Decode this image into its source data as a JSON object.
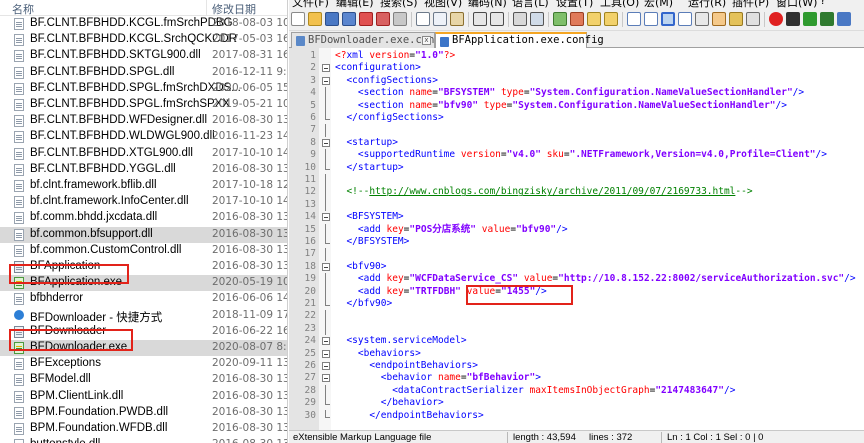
{
  "explorer": {
    "col_name": "名称",
    "col_date": "修改日期",
    "files": [
      {
        "name": "BF.CLNT.BFBHDD.KCGL.fmSrchPDBG",
        "date": "2018-08-03 10:",
        "icon": "file"
      },
      {
        "name": "BF.CLNT.BFBHDD.KCGL.SrchQCKCDR",
        "date": "2017-05-03 16:",
        "icon": "file"
      },
      {
        "name": "BF.CLNT.BFBHDD.SKTGL900.dll",
        "date": "2017-08-31 16:",
        "icon": "file"
      },
      {
        "name": "BF.CLNT.BFBHDD.SPGL.dll",
        "date": "2016-12-11 9:1",
        "icon": "file"
      },
      {
        "name": "BF.CLNT.BFBHDD.SPGL.fmSrchDXDS...",
        "date": "2020-06-05 15:",
        "icon": "file"
      },
      {
        "name": "BF.CLNT.BFBHDD.SPGL.fmSrchSPXX",
        "date": "2019-05-21 10:",
        "icon": "file"
      },
      {
        "name": "BF.CLNT.BFBHDD.WFDesigner.dll",
        "date": "2016-08-30 13:",
        "icon": "file"
      },
      {
        "name": "BF.CLNT.BFBHDD.WLDWGL900.dll",
        "date": "2016-11-23 14:",
        "icon": "file"
      },
      {
        "name": "BF.CLNT.BFBHDD.XTGL900.dll",
        "date": "2017-10-10 14:",
        "icon": "file"
      },
      {
        "name": "BF.CLNT.BFBHDD.YGGL.dll",
        "date": "2016-08-30 13:",
        "icon": "file"
      },
      {
        "name": "bf.clnt.framework.bflib.dll",
        "date": "2017-10-18 12:",
        "icon": "file"
      },
      {
        "name": "bf.clnt.framework.InfoCenter.dll",
        "date": "2017-10-10 14:",
        "icon": "file"
      },
      {
        "name": "bf.comm.bhdd.jxcdata.dll",
        "date": "2016-08-30 13:",
        "icon": "file"
      },
      {
        "name": "bf.common.bfsupport.dll",
        "date": "2016-08-30 13:",
        "icon": "file",
        "selected": true
      },
      {
        "name": "bf.common.CustomControl.dll",
        "date": "2016-08-30 13:",
        "icon": "file"
      },
      {
        "name": "BFApplication",
        "date": "2016-08-30 13:",
        "icon": "gear"
      },
      {
        "name": "BFApplication.exe",
        "date": "2020-05-19 10:",
        "icon": "exe",
        "selected": true
      },
      {
        "name": "bfbhderror",
        "date": "2016-06-06 14:",
        "icon": "file"
      },
      {
        "name": "BFDownloader - 快捷方式",
        "date": "2018-11-09 17:",
        "icon": "shortcut"
      },
      {
        "name": "BFDownloader",
        "date": "2016-06-22 16:",
        "icon": "gear"
      },
      {
        "name": "BFDownloader.exe",
        "date": "2020-08-07 8:2",
        "icon": "exe",
        "selected": true
      },
      {
        "name": "BFExceptions",
        "date": "2020-09-11 13:",
        "icon": "file"
      },
      {
        "name": "BFModel.dll",
        "date": "2016-08-30 13:",
        "icon": "file"
      },
      {
        "name": "BPM.ClientLink.dll",
        "date": "2016-08-30 13:",
        "icon": "file"
      },
      {
        "name": "BPM.Foundation.PWDB.dll",
        "date": "2016-08-30 13:",
        "icon": "file"
      },
      {
        "name": "BPM.Foundation.WFDB.dll",
        "date": "2016-08-30 13:",
        "icon": "file"
      },
      {
        "name": "buttonstyle.dll",
        "date": "2016-08-30 13:",
        "icon": "file"
      }
    ]
  },
  "npp": {
    "menu": [
      "文件(F)",
      "编辑(E)",
      "搜索(S)",
      "视图(V)",
      "编码(N)",
      "语言(L)",
      "设置(T)",
      "工具(O)",
      "宏(M)",
      "运行(R)",
      "插件(P)",
      "窗口(W)",
      "?"
    ],
    "tabs": [
      {
        "label": "BFDownloader.exe.config",
        "active": false,
        "close": "x"
      },
      {
        "label": "BFApplication.exe.config",
        "active": true,
        "close": "x"
      }
    ],
    "colors": {
      "tag": "#0000ff",
      "attr": "#ff0000",
      "value": "#8000ff",
      "comment": "#008000",
      "highlight_box": "#e2231a",
      "active_tab_accent": "#f5a623"
    },
    "lines": [
      {
        "n": "1",
        "fold": "none",
        "tokens": [
          [
            "pi",
            "<?"
          ],
          [
            "tag",
            "xml"
          ],
          [
            "txt",
            " "
          ],
          [
            "attr",
            "version"
          ],
          [
            "txt",
            "="
          ],
          [
            "val",
            "\"1.0\""
          ],
          [
            "pi",
            "?>"
          ]
        ]
      },
      {
        "n": "2",
        "fold": "box",
        "tokens": [
          [
            "tag",
            "<configuration>"
          ]
        ]
      },
      {
        "n": "3",
        "fold": "box",
        "tokens": [
          [
            "txt",
            "  "
          ],
          [
            "tag",
            "<configSections>"
          ]
        ]
      },
      {
        "n": "4",
        "fold": "line",
        "tokens": [
          [
            "txt",
            "    "
          ],
          [
            "tag",
            "<section "
          ],
          [
            "attr",
            "name"
          ],
          [
            "txt",
            "="
          ],
          [
            "val",
            "\"BFSYSTEM\""
          ],
          [
            "txt",
            " "
          ],
          [
            "attr",
            "type"
          ],
          [
            "txt",
            "="
          ],
          [
            "val",
            "\"System.Configuration.NameValueSectionHandler\""
          ],
          [
            "tag",
            "/>"
          ]
        ]
      },
      {
        "n": "5",
        "fold": "line",
        "tokens": [
          [
            "txt",
            "    "
          ],
          [
            "tag",
            "<section "
          ],
          [
            "attr",
            "name"
          ],
          [
            "txt",
            "="
          ],
          [
            "val",
            "\"bfv90\""
          ],
          [
            "txt",
            " "
          ],
          [
            "attr",
            "type"
          ],
          [
            "txt",
            "="
          ],
          [
            "val",
            "\"System.Configuration.NameValueSectionHandler\""
          ],
          [
            "tag",
            "/>"
          ]
        ]
      },
      {
        "n": "6",
        "fold": "end",
        "tokens": [
          [
            "txt",
            "  "
          ],
          [
            "tag",
            "</configSections>"
          ]
        ]
      },
      {
        "n": "7",
        "fold": "line",
        "tokens": []
      },
      {
        "n": "8",
        "fold": "box",
        "tokens": [
          [
            "txt",
            "  "
          ],
          [
            "tag",
            "<startup>"
          ]
        ]
      },
      {
        "n": "9",
        "fold": "line",
        "tokens": [
          [
            "txt",
            "    "
          ],
          [
            "tag",
            "<supportedRuntime "
          ],
          [
            "attr",
            "version"
          ],
          [
            "txt",
            "="
          ],
          [
            "val",
            "\"v4.0\""
          ],
          [
            "txt",
            " "
          ],
          [
            "attr",
            "sku"
          ],
          [
            "txt",
            "="
          ],
          [
            "val",
            "\".NETFramework,Version=v4.0,Profile=Client\""
          ],
          [
            "tag",
            "/>"
          ]
        ]
      },
      {
        "n": "10",
        "fold": "end",
        "tokens": [
          [
            "txt",
            "  "
          ],
          [
            "tag",
            "</startup>"
          ]
        ]
      },
      {
        "n": "11",
        "fold": "line",
        "tokens": []
      },
      {
        "n": "12",
        "fold": "line",
        "tokens": [
          [
            "txt",
            "  "
          ],
          [
            "com",
            "<!--"
          ],
          [
            "link",
            "http://www.cnblogs.com/bingzisky/archive/2011/09/07/2169733.html"
          ],
          [
            "com",
            "-->"
          ]
        ]
      },
      {
        "n": "13",
        "fold": "line",
        "tokens": []
      },
      {
        "n": "14",
        "fold": "box",
        "tokens": [
          [
            "txt",
            "  "
          ],
          [
            "tag",
            "<BFSYSTEM>"
          ]
        ]
      },
      {
        "n": "15",
        "fold": "line",
        "tokens": [
          [
            "txt",
            "    "
          ],
          [
            "tag",
            "<add "
          ],
          [
            "attr",
            "key"
          ],
          [
            "txt",
            "="
          ],
          [
            "val",
            "\"POS分店系统\""
          ],
          [
            "txt",
            " "
          ],
          [
            "attr",
            "value"
          ],
          [
            "txt",
            "="
          ],
          [
            "val",
            "\"bfv90\""
          ],
          [
            "tag",
            "/>"
          ]
        ]
      },
      {
        "n": "16",
        "fold": "end",
        "tokens": [
          [
            "txt",
            "  "
          ],
          [
            "tag",
            "</BFSYSTEM>"
          ]
        ]
      },
      {
        "n": "17",
        "fold": "line",
        "tokens": []
      },
      {
        "n": "18",
        "fold": "box",
        "tokens": [
          [
            "txt",
            "  "
          ],
          [
            "tag",
            "<bfv90>"
          ]
        ]
      },
      {
        "n": "19",
        "fold": "line",
        "tokens": [
          [
            "txt",
            "    "
          ],
          [
            "tag",
            "<add "
          ],
          [
            "attr",
            "key"
          ],
          [
            "txt",
            "="
          ],
          [
            "val",
            "\"WCFDataService_CS\""
          ],
          [
            "txt",
            " "
          ],
          [
            "attr",
            "value"
          ],
          [
            "txt",
            "="
          ],
          [
            "val",
            "\"http://10.8.152.22:8002/serviceAuthorization.svc\""
          ],
          [
            "tag",
            "/>"
          ]
        ]
      },
      {
        "n": "20",
        "fold": "line",
        "tokens": [
          [
            "txt",
            "    "
          ],
          [
            "tag",
            "<add "
          ],
          [
            "attr",
            "key"
          ],
          [
            "txt",
            "="
          ],
          [
            "val",
            "\"TRTFDBH\""
          ],
          [
            "txt",
            " "
          ],
          [
            "attr",
            "value"
          ],
          [
            "txt",
            "="
          ],
          [
            "val",
            "\"1455\""
          ],
          [
            "tag",
            "/>"
          ]
        ]
      },
      {
        "n": "21",
        "fold": "end",
        "tokens": [
          [
            "txt",
            "  "
          ],
          [
            "tag",
            "</bfv90>"
          ]
        ]
      },
      {
        "n": "22",
        "fold": "line",
        "tokens": []
      },
      {
        "n": "23",
        "fold": "line",
        "tokens": []
      },
      {
        "n": "24",
        "fold": "box",
        "tokens": [
          [
            "txt",
            "  "
          ],
          [
            "tag",
            "<system.serviceModel>"
          ]
        ]
      },
      {
        "n": "25",
        "fold": "box",
        "tokens": [
          [
            "txt",
            "    "
          ],
          [
            "tag",
            "<behaviors>"
          ]
        ]
      },
      {
        "n": "26",
        "fold": "box",
        "tokens": [
          [
            "txt",
            "      "
          ],
          [
            "tag",
            "<endpointBehaviors>"
          ]
        ]
      },
      {
        "n": "27",
        "fold": "box",
        "tokens": [
          [
            "txt",
            "        "
          ],
          [
            "tag",
            "<behavior "
          ],
          [
            "attr",
            "name"
          ],
          [
            "txt",
            "="
          ],
          [
            "val",
            "\"bfBehavior\""
          ],
          [
            "tag",
            ">"
          ]
        ]
      },
      {
        "n": "28",
        "fold": "line",
        "tokens": [
          [
            "txt",
            "          "
          ],
          [
            "tag",
            "<dataContractSerializer "
          ],
          [
            "attr",
            "maxItemsInObjectGraph"
          ],
          [
            "txt",
            "="
          ],
          [
            "val",
            "\"2147483647\""
          ],
          [
            "tag",
            "/>"
          ]
        ]
      },
      {
        "n": "29",
        "fold": "end",
        "tokens": [
          [
            "txt",
            "        "
          ],
          [
            "tag",
            "</behavior>"
          ]
        ]
      },
      {
        "n": "30",
        "fold": "end",
        "tokens": [
          [
            "txt",
            "      "
          ],
          [
            "tag",
            "</endpointBehaviors>"
          ]
        ]
      }
    ],
    "status": {
      "file_type": "eXtensible Markup Language file",
      "length": "length : 43,594",
      "lines": "lines : 372",
      "position": "Ln : 1    Col : 1    Sel : 0 | 0"
    }
  }
}
